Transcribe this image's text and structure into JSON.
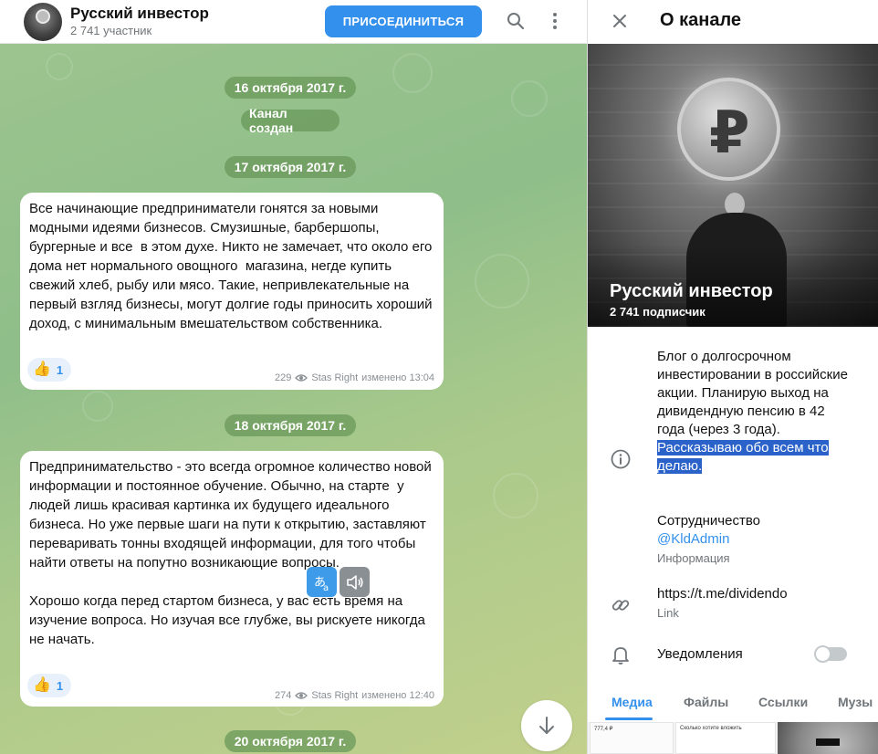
{
  "chat": {
    "title": "Русский инвестор",
    "subtitle": "2 741 участник",
    "join_label": "ПРИСОЕДИНИТЬСЯ",
    "icons": {
      "search": "search-icon",
      "menu": "more-vertical-icon",
      "scroll_down": "arrow-down-icon"
    },
    "dates": [
      "16 октября 2017 г.",
      "17 октября 2017 г.",
      "18 октября 2017 г.",
      "20 октября 2017 г."
    ],
    "service_message": "Канал создан",
    "messages": [
      {
        "text": "Все начинающие предприниматели гонятся за новыми модными идеями бизнесов. Смузишные, барбершопы, бургерные и все  в этом духе. Никто не замечает, что около его дома нет нормального овощного  магазина, негде купить свежий хлеб, рыбу или мясо. Такие, непривлекательные на первый взгляд бизнесы, могут долгие годы приносить хороший доход, с минимальным вмешательством собственника.",
        "reaction_emoji": "👍",
        "reaction_count": "1",
        "views": "229",
        "author": "Stas Right",
        "edited": "изменено 13:04"
      },
      {
        "text": "Предпринимательство - это всегда огромное количество новой информации и постоянное обучение. Обычно, на старте  у людей лишь красивая картинка их будущего идеального бизнеса. Но уже первые шаги на пути к открытию, заставляют переваривать тонны входящей информации, для того чтобы найти ответы на попутно возникающие вопросы.\n\nХорошо когда перед стартом бизнеса, у вас есть время на изучение вопроса. Но изучая все глубже, вы рискуете никогда не начать.",
        "reaction_emoji": "👍",
        "reaction_count": "1",
        "views": "274",
        "author": "Stas Right",
        "edited": "изменено 12:40"
      }
    ]
  },
  "about": {
    "header_title": "О канале",
    "cover_title": "Русский инвестор",
    "cover_subtitle": "2 741 подписчик",
    "description_plain": "Блог о долгосрочном инвестировании в российские акции. Планирую выход на дивидендную пенсию в 42 года (через 3 года). ",
    "description_selected": "Рассказываю обо всем что делаю.",
    "contact_value": "Сотрудничество",
    "contact_link": "@KldAdmin",
    "contact_label": "Информация",
    "link_value": "https://t.me/dividendo",
    "link_label": "Link",
    "notifications_label": "Уведомления",
    "notifications_on": false,
    "tabs": [
      "Медиа",
      "Файлы",
      "Ссылки",
      "Музы"
    ],
    "active_tab": 0,
    "media": {
      "thumb1_text": "777,4 ₽",
      "thumb2_text": "Сколько хотите вложить"
    }
  },
  "colors": {
    "accent": "#3390ec",
    "selection": "#2a62c9",
    "chat_bg": "#9cc48e",
    "date_pill": "#6a985a"
  }
}
